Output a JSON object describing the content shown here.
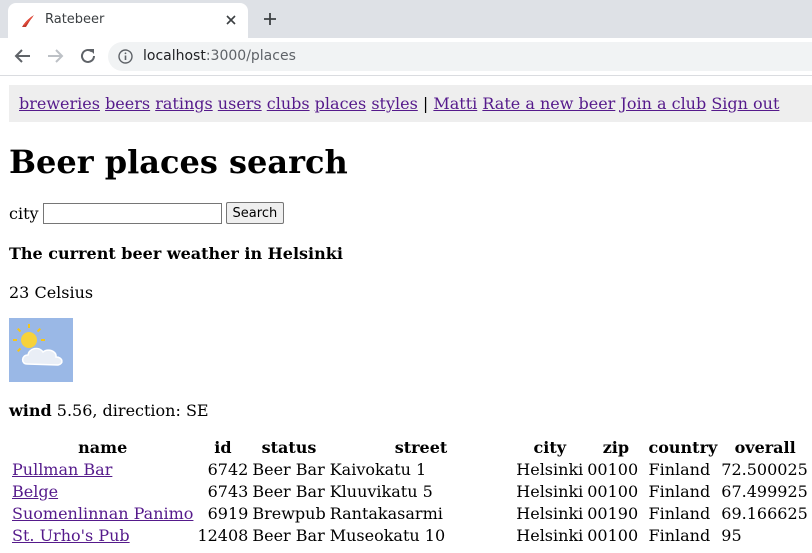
{
  "browser": {
    "tab_title": "Ratebeer",
    "url_host": "localhost",
    "url_path": ":3000/places"
  },
  "nav": {
    "links": [
      "breweries",
      "beers",
      "ratings",
      "users",
      "clubs",
      "places",
      "styles"
    ],
    "separator": "|",
    "user_links": [
      "Matti",
      "Rate a new beer",
      "Join a club",
      "Sign out"
    ]
  },
  "page": {
    "title": "Beer places search",
    "search_label": "city",
    "search_value": "",
    "search_button": "Search"
  },
  "weather": {
    "title": "The current beer weather in Helsinki",
    "temperature": "23 Celsius",
    "icon": "partly-cloudy-icon",
    "wind_label": "wind",
    "wind_text": " 5.56, direction: SE"
  },
  "table": {
    "headers": [
      "name",
      "id",
      "status",
      "street",
      "city",
      "zip",
      "country",
      "overall"
    ],
    "rows": [
      {
        "name": "Pullman Bar",
        "id": "6742",
        "status": "Beer Bar",
        "street": "Kaivokatu 1",
        "city": "Helsinki",
        "zip": "00100",
        "country": "Finland",
        "overall": "72.500025"
      },
      {
        "name": "Belge",
        "id": "6743",
        "status": "Beer Bar",
        "street": "Kluuvikatu 5",
        "city": "Helsinki",
        "zip": "00100",
        "country": "Finland",
        "overall": "67.499925"
      },
      {
        "name": "Suomenlinnan Panimo",
        "id": "6919",
        "status": "Brewpub",
        "street": "Rantakasarmi",
        "city": "Helsinki",
        "zip": "00190",
        "country": "Finland",
        "overall": "69.166625"
      },
      {
        "name": "St. Urho's Pub",
        "id": "12408",
        "status": "Beer Bar",
        "street": "Museokatu 10",
        "city": "Helsinki",
        "zip": "00100",
        "country": "Finland",
        "overall": "95"
      }
    ]
  },
  "colors": {
    "link": "#551a8b",
    "navbar_bg": "#eeeeee",
    "chrome_bg": "#dee1e6"
  }
}
